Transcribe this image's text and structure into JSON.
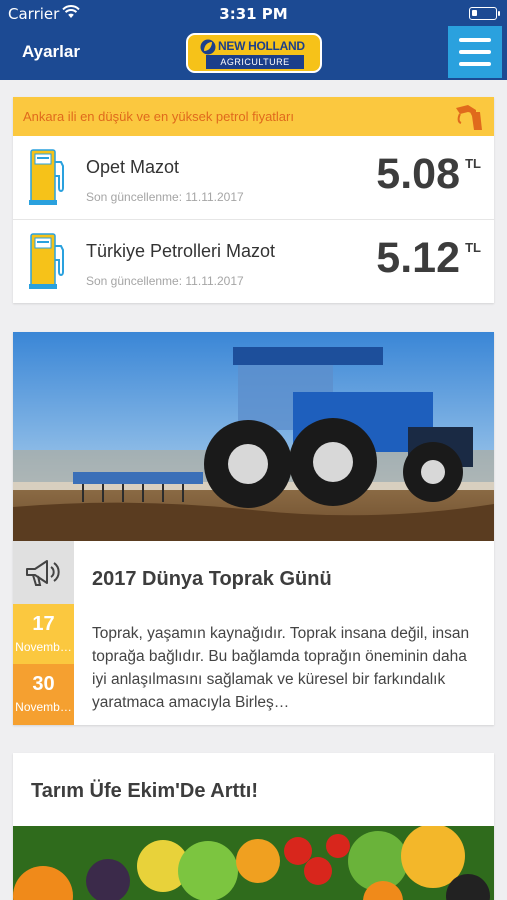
{
  "status_bar": {
    "carrier": "Carrier",
    "time": "3:31 PM"
  },
  "nav": {
    "settings_label": "Ayarlar",
    "logo_brand": "NEW HOLLAND",
    "logo_sub": "AGRICULTURE"
  },
  "fuel": {
    "header": "Ankara ili en düşük ve en yüksek petrol fiyatları",
    "items": [
      {
        "name": "Opet Mazot",
        "updated": "Son güncellenme: 11.11.2017",
        "price": "5.08",
        "unit": "TL"
      },
      {
        "name": "Türkiye Petrolleri Mazot",
        "updated": "Son güncellenme: 11.11.2017",
        "price": "5.12",
        "unit": "TL"
      }
    ]
  },
  "news": [
    {
      "title": "2017 Dünya Toprak Günü",
      "body": "Toprak, yaşamın kaynağıdır. Toprak insana değil, insan toprağa bağlıdır. Bu bağlamda toprağın öneminin daha iyi anlaşılmasını sağlamak ve küresel bir farkındalık yaratmaca amacıyla Birleş…",
      "start_day": "17",
      "start_month": "Novemb…",
      "end_day": "30",
      "end_month": "Novemb…"
    },
    {
      "title": "Tarım Üfe Ekim'De Arttı!"
    }
  ],
  "colors": {
    "nav_blue": "#1c4a93",
    "menu_blue": "#2aa1de",
    "fuel_header_yellow": "#fbc83f",
    "fuel_header_text": "#e06a1c",
    "date_orange": "#f5a030"
  }
}
